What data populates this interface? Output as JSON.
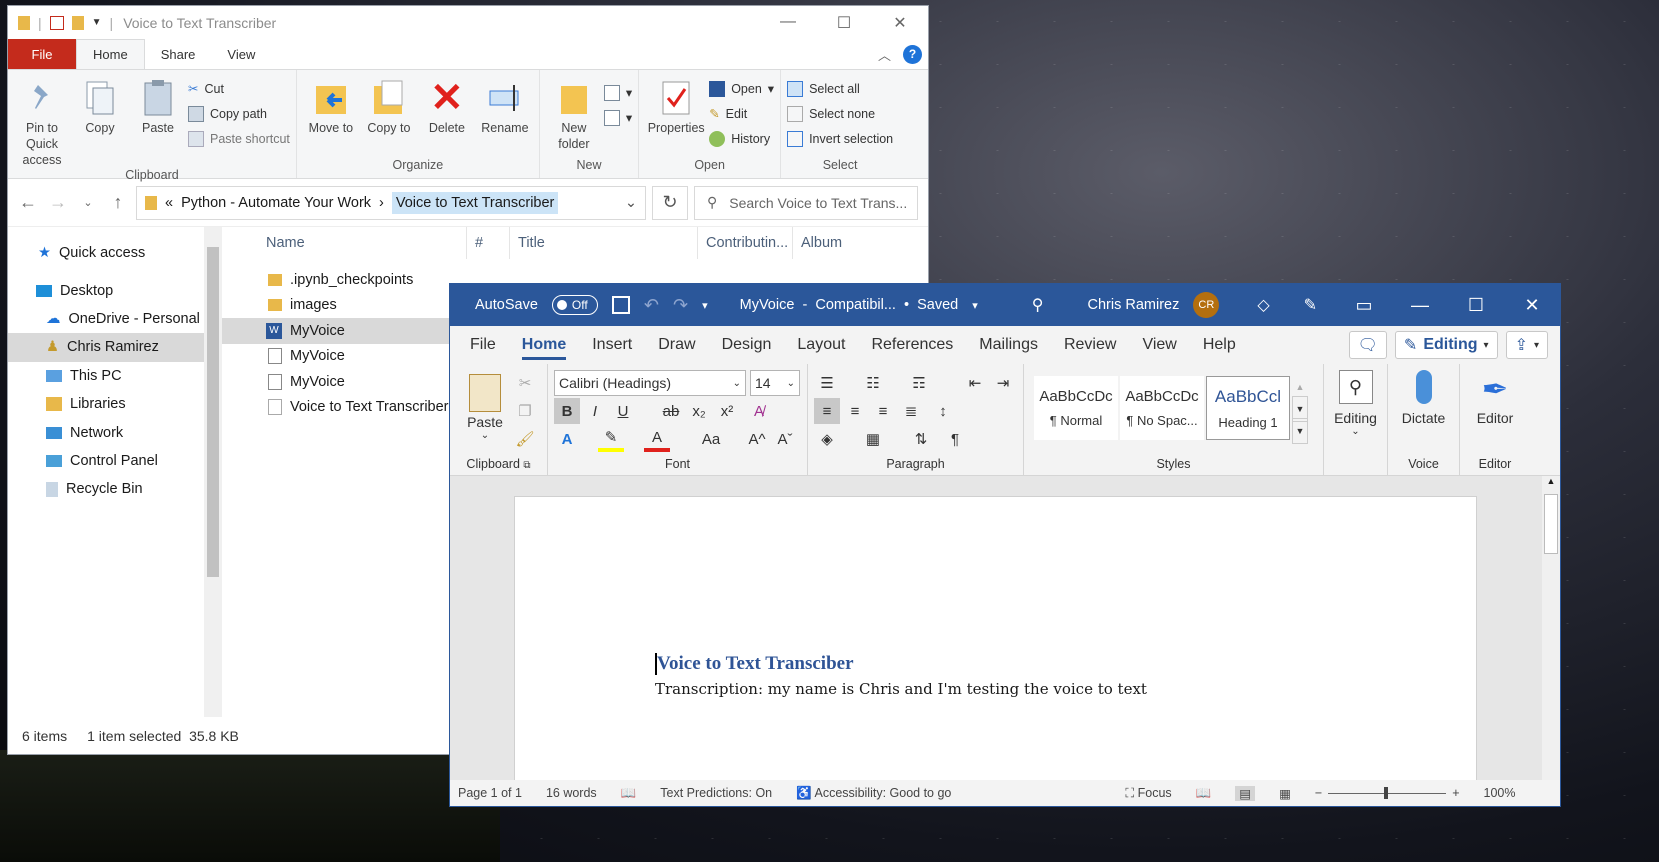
{
  "explorer": {
    "title": "Voice to Text Transcriber",
    "tabs": {
      "file": "File",
      "home": "Home",
      "share": "Share",
      "view": "View"
    },
    "help": "?",
    "ribbon": {
      "pin": "Pin to Quick access",
      "copy": "Copy",
      "paste": "Paste",
      "cut": "Cut",
      "copy_path": "Copy path",
      "paste_shortcut": "Paste shortcut",
      "clipboard": "Clipboard",
      "move_to": "Move to",
      "copy_to": "Copy to",
      "delete": "Delete",
      "rename": "Rename",
      "organize": "Organize",
      "new_folder": "New folder",
      "new": "New",
      "properties": "Properties",
      "open": "Open",
      "edit": "Edit",
      "history": "History",
      "open_group": "Open",
      "select_all": "Select all",
      "select_none": "Select none",
      "invert_selection": "Invert selection",
      "select": "Select"
    },
    "address": {
      "parent": "Python - Automate Your Work",
      "current": "Voice to Text Transcriber",
      "search_placeholder": "Search Voice to Text Trans..."
    },
    "nav": [
      "Quick access",
      "Desktop",
      "OneDrive - Personal",
      "Chris Ramirez",
      "This PC",
      "Libraries",
      "Network",
      "Control Panel",
      "Recycle Bin"
    ],
    "columns": [
      "Name",
      "#",
      "Title",
      "Contributin...",
      "Album"
    ],
    "files": [
      ".ipynb_checkpoints",
      "images",
      "MyVoice",
      "MyVoice",
      "MyVoice",
      "Voice to Text Transcriber"
    ],
    "status": {
      "count": "6 items",
      "selected": "1 item selected  35.8 KB"
    }
  },
  "word": {
    "autosave": "AutoSave",
    "autosave_state": "Off",
    "doc_title": "MyVoice  -  Compatibil...  •  Saved",
    "user": "Chris Ramirez",
    "initials": "CR",
    "tabs": [
      "File",
      "Home",
      "Insert",
      "Draw",
      "Design",
      "Layout",
      "References",
      "Mailings",
      "Review",
      "View",
      "Help"
    ],
    "editing_mode": "Editing",
    "ribbon": {
      "paste": "Paste",
      "clipboard": "Clipboard",
      "font_name": "Calibri (Headings)",
      "font_size": "14",
      "font": "Font",
      "paragraph": "Paragraph",
      "style_preview": "AaBbCcDc",
      "style_preview_h": "AaBbCcl",
      "style_normal": "¶ Normal",
      "style_nospace": "¶ No Spac...",
      "style_heading": "Heading 1",
      "styles": "Styles",
      "editing": "Editing",
      "dictate": "Dictate",
      "voice": "Voice",
      "editor": "Editor",
      "editor_group": "Editor"
    },
    "document": {
      "heading": "Voice to Text Transciber",
      "body": "Transcription: my name is Chris and I'm testing the voice to text"
    },
    "status": {
      "page": "Page 1 of 1",
      "words": "16 words",
      "predictions": "Text Predictions: On",
      "accessibility": "Accessibility: Good to go",
      "focus": "Focus",
      "zoom": "100%"
    }
  }
}
